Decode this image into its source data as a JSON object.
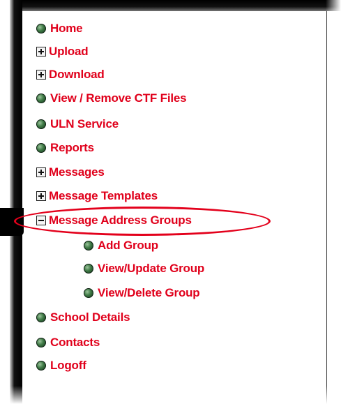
{
  "menu": {
    "items": [
      {
        "label": "Home",
        "marker": "bullet-icon"
      },
      {
        "label": "Upload",
        "marker": "expand-icon"
      },
      {
        "label": "Download",
        "marker": "expand-icon"
      },
      {
        "label": "View / Remove CTF Files",
        "marker": "bullet-icon"
      },
      {
        "label": "ULN Service",
        "marker": "bullet-icon"
      },
      {
        "label": "Reports",
        "marker": "bullet-icon"
      },
      {
        "label": "Messages",
        "marker": "expand-icon"
      },
      {
        "label": "Message Templates",
        "marker": "expand-icon"
      },
      {
        "label": "Message Address Groups",
        "marker": "collapse-icon"
      },
      {
        "label": "Add Group",
        "marker": "bullet-icon"
      },
      {
        "label": "View/Update Group",
        "marker": "bullet-icon"
      },
      {
        "label": "View/Delete Group",
        "marker": "bullet-icon"
      },
      {
        "label": "School Details",
        "marker": "bullet-icon"
      },
      {
        "label": "Contacts",
        "marker": "bullet-icon"
      },
      {
        "label": "Logoff",
        "marker": "bullet-icon"
      }
    ]
  },
  "colors": {
    "link": "#e0001b",
    "highlight": "#e3001b",
    "bullet": "#3f7a46"
  }
}
